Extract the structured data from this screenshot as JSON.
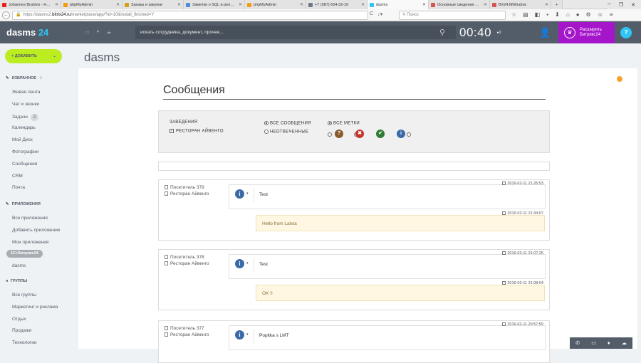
{
  "browser": {
    "tabs": [
      {
        "label": "Johannes Brahms - Н…",
        "color": "#e62117",
        "active": false
      },
      {
        "label": "phpMyAdmin",
        "color": "#f39c12",
        "active": false
      },
      {
        "label": "Заказы и закупки",
        "color": "#d4a017",
        "active": false
      },
      {
        "label": "Заметки о SQL и рел…",
        "color": "#4a90d9",
        "active": false
      },
      {
        "label": "phpMyAdmin",
        "color": "#f39c12",
        "active": false
      },
      {
        "label": "+7 (987) 654-32-10",
        "color": "#6c7a89",
        "active": false
      },
      {
        "label": "dasms",
        "color": "#2fc6f6",
        "active": true
      },
      {
        "label": "Основные сведения …",
        "color": "#d9534f",
        "active": false
      },
      {
        "label": "BX24.fitWindow",
        "color": "#d9534f",
        "active": false
      }
    ],
    "new_tab": "+",
    "url_prefix": "https://dasms2.",
    "url_host": "bitrix24.ru",
    "url_rest": "/marketplace/app/?id=10&install_finished=Y",
    "search_placeholder": "Поиск"
  },
  "header": {
    "logo_main": "dasms",
    "logo_num": "24",
    "search_placeholder": "искать сотрудника, документ, прочее...",
    "clock": "00:40",
    "clock_status": "0",
    "expand_line1": "Расширить",
    "expand_line2": "Битрикс24",
    "help": "?"
  },
  "sidebar": {
    "add_button": "ДОБАВИТЬ",
    "favorites_title": "ИЗБРАННОЕ",
    "favorites": [
      {
        "label": "Живая лента"
      },
      {
        "label": "Чат и звонки"
      },
      {
        "label": "Задачи",
        "counter": "2"
      },
      {
        "label": "Календарь"
      },
      {
        "label": "Мой Диск"
      },
      {
        "label": "Фотографии"
      },
      {
        "label": "Сообщения"
      },
      {
        "label": "CRM"
      },
      {
        "label": "Почта"
      }
    ],
    "apps_title": "ПРИЛОЖЕНИЯ",
    "apps": [
      {
        "label": "Все приложения"
      },
      {
        "label": "Добавить приложение"
      },
      {
        "label": "Мои приложения"
      },
      {
        "label": "1С+Битрикс24"
      },
      {
        "label": "dasms"
      }
    ],
    "groups_title": "ГРУППЫ",
    "groups": [
      {
        "label": "Все группы"
      },
      {
        "label": "Маркетинг и реклама"
      },
      {
        "label": "Отдых"
      },
      {
        "label": "Продажи"
      },
      {
        "label": "Технологии"
      }
    ]
  },
  "page_title": "dasms",
  "app": {
    "heading": "Сообщения",
    "filter": {
      "venues_label": "ЗАВЕДЕНИЯ",
      "venue": "РЕСТОРАН АЙВЕНГО",
      "venue_checked": true,
      "all_messages": "ВСЕ СООБЩЕНИЯ",
      "unanswered": "НЕОТВЕЧЕННЫЕ",
      "all_tags": "ВСЕ МЕТКИ",
      "marks": [
        {
          "icon": "question-icon",
          "glyph": "?",
          "color": "#8b5a2b"
        },
        {
          "icon": "cross-icon",
          "glyph": "✖",
          "color": "#c9302c"
        },
        {
          "icon": "check-icon",
          "glyph": "✔",
          "color": "#2e7d32"
        },
        {
          "icon": "info-icon",
          "glyph": "i",
          "color": "#3a6aa8"
        }
      ]
    },
    "messages": [
      {
        "visitor": "Посетитель 379",
        "venue": "Ресторан Айвенго",
        "text": "Test",
        "time": "2016-02-11 21:25:53",
        "reply_text": "Hello from Latvia",
        "reply_time": "2016-02-11 21:34:07"
      },
      {
        "visitor": "Посетитель 378",
        "venue": "Ресторан Айвенго",
        "text": "Test",
        "time": "2016-02-11 21:07:26",
        "reply_text": "OK !!",
        "reply_time": "2016-02-11 21:08:04"
      },
      {
        "visitor": "Посетитель 377",
        "venue": "Ресторан Айвенго",
        "text": "Popitka s LMT",
        "time": "2016-02-11 20:57:59"
      }
    ]
  }
}
